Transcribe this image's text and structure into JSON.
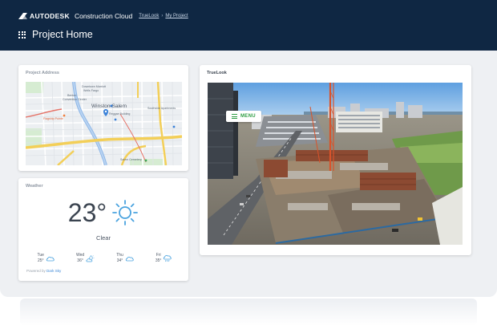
{
  "header": {
    "brand": "AUTODESK",
    "product": "Construction Cloud",
    "breadcrumbs": [
      "TrueLook",
      "My Project"
    ],
    "breadcrumb_separator": "›",
    "page_title": "Project Home",
    "background_color": "#0f2743"
  },
  "address_card": {
    "title": "Project Address",
    "map_labels": {
      "l1": "Downtown Marriott",
      "l2": "Wells Fargo",
      "l3": "Benton",
      "l4": "Convention Center",
      "l5": "Winston-Salem",
      "l6": "Reggae Building",
      "l7": "Southside Apartments",
      "l8": "Flagship Pointe",
      "l9": "Salem Cemetery"
    }
  },
  "weather_card": {
    "title": "Weather",
    "temperature": "23°",
    "condition": "Clear",
    "forecast": [
      {
        "day": "Tue",
        "temp": "25°",
        "icon": "cloud-icon"
      },
      {
        "day": "Wed",
        "temp": "36°",
        "icon": "sun-cloud-icon"
      },
      {
        "day": "Thu",
        "temp": "34°",
        "icon": "cloud-icon"
      },
      {
        "day": "Fri",
        "temp": "35°",
        "icon": "rain-cloud-icon"
      }
    ],
    "powered_prefix": "Powered by ",
    "powered_link": "Dark Sky"
  },
  "truelook_card": {
    "title": "TrueLook",
    "menu_label": "MENU"
  },
  "colors": {
    "accent_green": "#2f9e44",
    "sun_blue": "#4aa3df",
    "link_blue": "#3a86d6"
  }
}
